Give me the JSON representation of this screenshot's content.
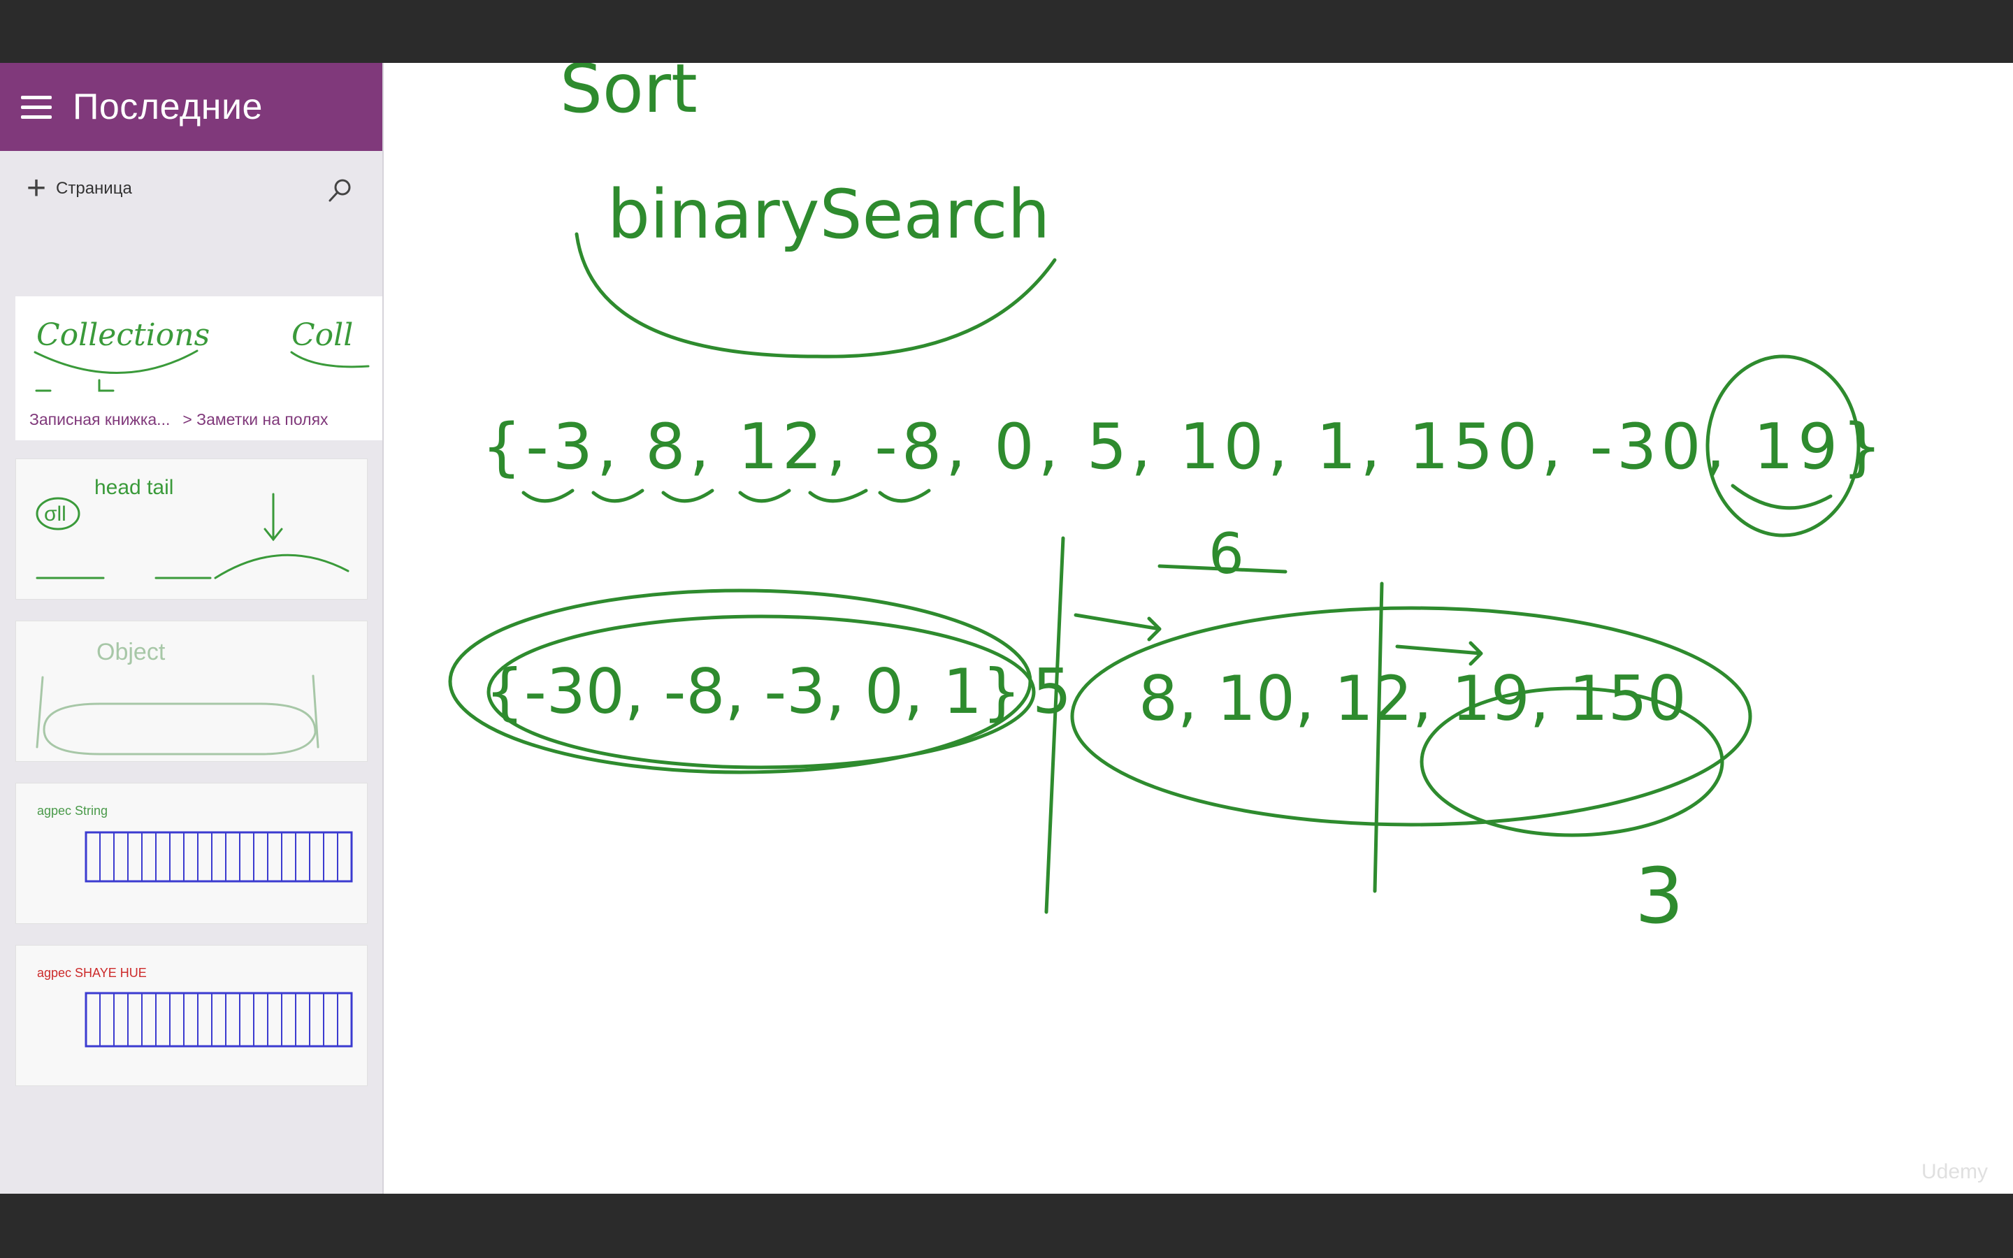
{
  "sidebar": {
    "title": "Последние",
    "add_page_label": "Страница",
    "breadcrumb": {
      "notebook": "Записная книжка...",
      "section": "> Заметки на полях"
    },
    "thumbnails": [
      {
        "text": "Collections"
      },
      {
        "text": "head tail"
      },
      {
        "text": "Object"
      },
      {
        "text": "agpec String"
      },
      {
        "text": "agpec SHAYE HUE"
      }
    ]
  },
  "canvas": {
    "ink_texts": {
      "sort": "Sort",
      "binary": "binarySearch",
      "array": "{-3, 8, 12, -8, 0, 5, 10, 1, 150, -30, 19}",
      "left": "{-30, -8, -3, 0, 1}",
      "pivot": "5",
      "right": "8, 10, 12, 19, 150",
      "six": "6",
      "three": "3"
    },
    "watermark": "Udemy"
  },
  "colors": {
    "accent": "#80397b",
    "ink": "#2e8b2e",
    "sidebar_bg": "#e9e7ec"
  }
}
